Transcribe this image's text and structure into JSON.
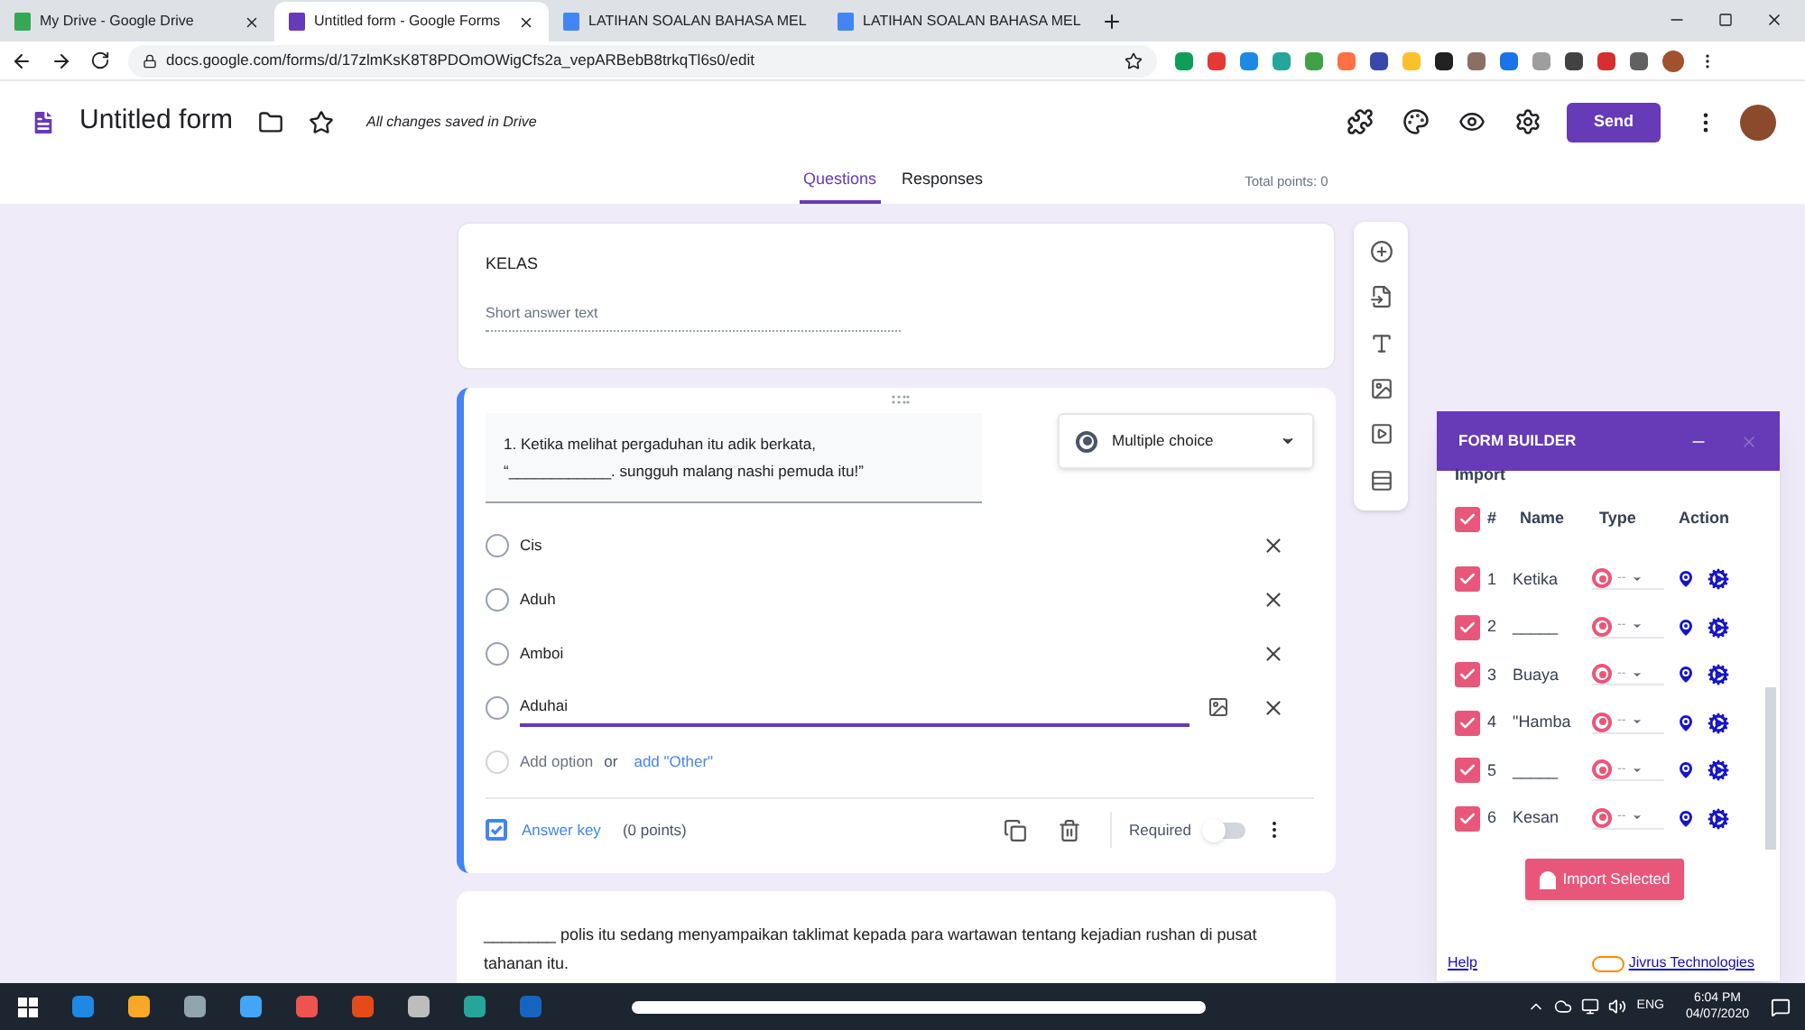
{
  "browser": {
    "tabs": [
      {
        "title": "My Drive - Google Drive",
        "selected": false,
        "kind": "drive"
      },
      {
        "title": "Untitled form - Google Forms",
        "selected": true,
        "kind": "forms"
      },
      {
        "title": "LATIHAN SOALAN BAHASA MEL",
        "selected": false,
        "kind": "docs"
      },
      {
        "title": "LATIHAN SOALAN BAHASA MEL",
        "selected": false,
        "kind": "docs"
      }
    ],
    "url": "docs.google.com/forms/d/17zlmKsK8T8PDOmOWigCfs2a_vepARBebB8trkqTl6s0/edit"
  },
  "header": {
    "title": "Untitled form",
    "save_status": "All changes saved in Drive",
    "send": "Send"
  },
  "form_tabs": [
    {
      "label": "Questions",
      "selected": true
    },
    {
      "label": "Responses",
      "selected": false
    }
  ],
  "total_points": "Total points: 0",
  "short_question": {
    "title": "KELAS",
    "placeholder": "Short answer text"
  },
  "question": {
    "lines": [
      "1. Ketika melihat pergaduhan itu adik berkata,",
      "“____________. sungguh malang nashi pemuda itu!”"
    ],
    "type": "Multiple choice",
    "options": [
      {
        "label": "Cis",
        "editing": false,
        "selected": false
      },
      {
        "label": "Aduh",
        "editing": false,
        "selected": false
      },
      {
        "label": "Amboi",
        "editing": false,
        "selected": false
      },
      {
        "label": "Aduhai",
        "editing": true,
        "selected": false
      }
    ],
    "add_option": "Add option",
    "or": "or",
    "add_other": "add \"Other\"",
    "answer_key": "Answer key",
    "points": "(0 points)",
    "required_label": "Required",
    "required": false
  },
  "next_question": "________ polis itu sedang menyampaikan taklimat kepada para wartawan tentang kejadian rushan di pusat tahanan itu.",
  "form_builder": {
    "title": "FORM BUILDER",
    "section": "Import",
    "header_checked": true,
    "columns": [
      "#",
      "Name",
      "Type",
      "Action"
    ],
    "rows": [
      {
        "number": "1",
        "name": "Ketika",
        "checked": true
      },
      {
        "number": "2",
        "name": "_____",
        "checked": true
      },
      {
        "number": "3",
        "name": "Buaya",
        "checked": true
      },
      {
        "number": "4",
        "name": "\"Hamba",
        "checked": true
      },
      {
        "number": "5",
        "name": "_____",
        "checked": true
      },
      {
        "number": "6",
        "name": "Kesan",
        "checked": true
      }
    ],
    "type_value": "--",
    "import_button": "Import Selected",
    "help": "Help",
    "company": "Jivrus Technologies"
  },
  "taskbar": {
    "language": "ENG",
    "time": "6:04 PM",
    "date": "04/07/2020"
  }
}
